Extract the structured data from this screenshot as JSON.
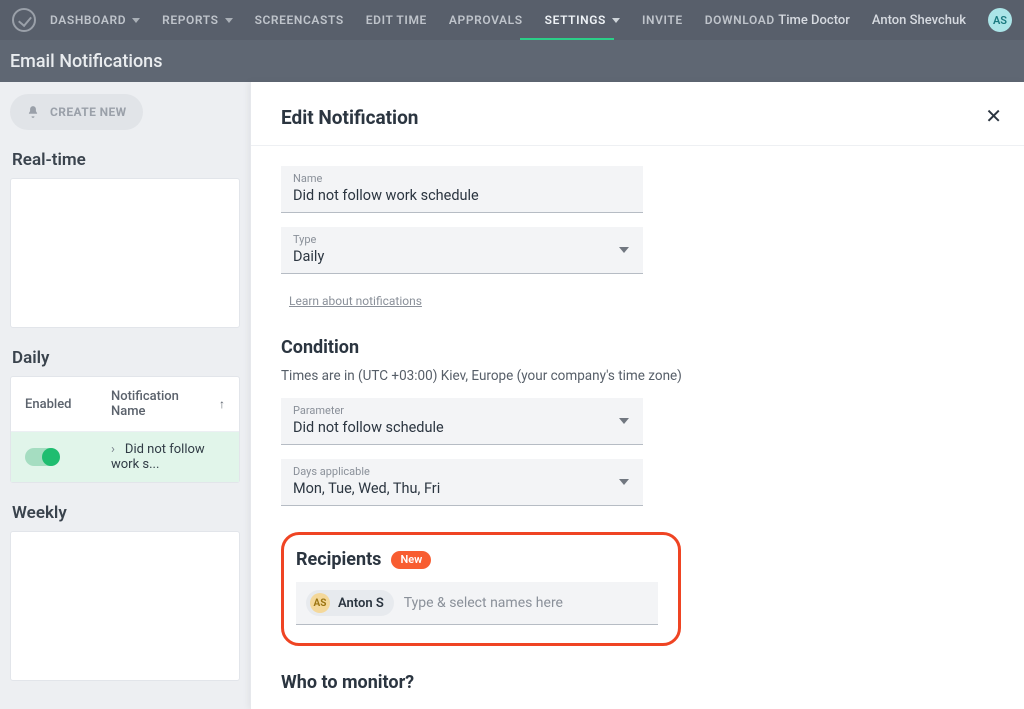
{
  "nav": {
    "items": [
      {
        "label": "DASHBOARD",
        "hasDropdown": true
      },
      {
        "label": "REPORTS",
        "hasDropdown": true
      },
      {
        "label": "SCREENCASTS",
        "hasDropdown": false
      },
      {
        "label": "EDIT TIME",
        "hasDropdown": false
      },
      {
        "label": "APPROVALS",
        "hasDropdown": false
      },
      {
        "label": "SETTINGS",
        "hasDropdown": true,
        "active": true
      },
      {
        "label": "INVITE",
        "hasDropdown": false
      },
      {
        "label": "DOWNLOAD",
        "hasDropdown": false
      }
    ],
    "product": "Time Doctor",
    "user": "Anton Shevchuk",
    "avatar_initials": "AS"
  },
  "subheader": {
    "title": "Email Notifications"
  },
  "sidebar": {
    "create_label": "CREATE NEW",
    "sections": {
      "realtime_title": "Real-time",
      "daily_title": "Daily",
      "weekly_title": "Weekly"
    },
    "daily_table": {
      "col_enabled": "Enabled",
      "col_name": "Notification Name",
      "rows": [
        {
          "enabled": true,
          "name": "Did not follow work s..."
        }
      ]
    }
  },
  "drawer": {
    "title": "Edit Notification",
    "name_label": "Name",
    "name_value": "Did not follow work schedule",
    "type_label": "Type",
    "type_value": "Daily",
    "learn_link": "Learn about notifications",
    "condition_title": "Condition",
    "tz_note": "Times are in (UTC +03:00) Kiev, Europe (your company's time zone)",
    "param_label": "Parameter",
    "param_value": "Did not follow schedule",
    "days_label": "Days applicable",
    "days_value": "Mon, Tue, Wed, Thu, Fri",
    "recipients_title": "Recipients",
    "new_badge": "New",
    "chip_initials": "AS",
    "chip_name": "Anton S",
    "recip_placeholder": "Type & select names here",
    "monitor_title": "Who to monitor?"
  }
}
